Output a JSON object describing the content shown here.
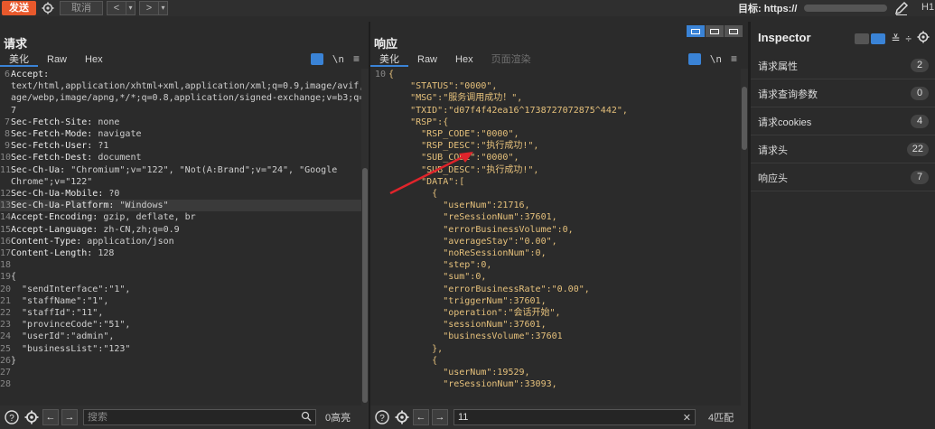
{
  "toolbar": {
    "send_label": "发送",
    "cancel_label": "取消",
    "back_label": "<",
    "forward_label": ">",
    "dropdown_label": "▾",
    "target_label": "目标: https://",
    "http_version": "H1"
  },
  "request": {
    "title": "请求",
    "tabs": [
      {
        "label": "美化"
      },
      {
        "label": "Raw"
      },
      {
        "label": "Hex"
      }
    ],
    "newline_label": "\\n",
    "lines": [
      {
        "n": "6",
        "k": "Accept:",
        "v": ""
      },
      {
        "n": "",
        "k": "",
        "v": "text/html,application/xhtml+xml,application/xml;q=0.9,image/avif,im"
      },
      {
        "n": "",
        "k": "",
        "v": "age/webp,image/apng,*/*;q=0.8,application/signed-exchange;v=b3;q=0."
      },
      {
        "n": "",
        "k": "",
        "v": "7"
      },
      {
        "n": "7",
        "k": "Sec-Fetch-Site:",
        "v": " none"
      },
      {
        "n": "8",
        "k": "Sec-Fetch-Mode:",
        "v": " navigate"
      },
      {
        "n": "9",
        "k": "Sec-Fetch-User:",
        "v": " ?1"
      },
      {
        "n": "10",
        "k": "Sec-Fetch-Dest:",
        "v": " document"
      },
      {
        "n": "11",
        "k": "Sec-Ch-Ua:",
        "v": " \"Chromium\";v=\"122\", \"Not(A:Brand\";v=\"24\", \"Google"
      },
      {
        "n": "",
        "k": "",
        "v": "Chrome\";v=\"122\""
      },
      {
        "n": "12",
        "k": "Sec-Ch-Ua-Mobile:",
        "v": " ?0"
      },
      {
        "n": "13",
        "k": "Sec-Ch-Ua-Platform:",
        "v": " \"Windows\""
      },
      {
        "n": "14",
        "k": "Accept-Encoding:",
        "v": " gzip, deflate, br"
      },
      {
        "n": "15",
        "k": "Accept-Language:",
        "v": " zh-CN,zh;q=0.9"
      },
      {
        "n": "16",
        "k": "Content-Type:",
        "v": " application/json"
      },
      {
        "n": "17",
        "k": "Content-Length:",
        "v": " 128"
      },
      {
        "n": "18",
        "k": "",
        "v": ""
      },
      {
        "n": "19",
        "k": "",
        "v": "{"
      },
      {
        "n": "20",
        "k": "",
        "v": "  \"sendInterface\":\"1\","
      },
      {
        "n": "21",
        "k": "",
        "v": "  \"staffName\":\"1\","
      },
      {
        "n": "22",
        "k": "",
        "v": "  \"staffId\":\"11\","
      },
      {
        "n": "23",
        "k": "",
        "v": "  \"provinceCode\":\"51\","
      },
      {
        "n": "24",
        "k": "",
        "v": "  \"userId\":\"admin\","
      },
      {
        "n": "25",
        "k": "",
        "v": "  \"businessList\":\"123\""
      },
      {
        "n": "26",
        "k": "",
        "v": "}"
      },
      {
        "n": "27",
        "k": "",
        "v": ""
      },
      {
        "n": "28",
        "k": "",
        "v": ""
      }
    ],
    "highlight_line": 11,
    "search_placeholder": "搜索",
    "match_count": "0高亮"
  },
  "response": {
    "title": "响应",
    "tabs": [
      {
        "label": "美化"
      },
      {
        "label": "Raw"
      },
      {
        "label": "Hex"
      },
      {
        "label": "页面渲染"
      }
    ],
    "newline_label": "\\n",
    "lines": [
      {
        "n": "10",
        "t": "{"
      },
      {
        "n": "",
        "t": "    \"STATUS\":\"0000\","
      },
      {
        "n": "",
        "t": "    \"MSG\":\"服务调用成功！\","
      },
      {
        "n": "",
        "t": "    \"TXID\":\"d07f4f42ea16^1738727072875^442\","
      },
      {
        "n": "",
        "t": "    \"RSP\":{"
      },
      {
        "n": "",
        "t": "      \"RSP_CODE\":\"0000\","
      },
      {
        "n": "",
        "t": "      \"RSP_DESC\":\"执行成功!\","
      },
      {
        "n": "",
        "t": "      \"SUB_CODE\":\"0000\","
      },
      {
        "n": "",
        "t": "      \"SUB_DESC\":\"执行成功!\","
      },
      {
        "n": "",
        "t": "      \"DATA\":["
      },
      {
        "n": "",
        "t": "        {"
      },
      {
        "n": "",
        "t": "          \"userNum\":21716,"
      },
      {
        "n": "",
        "t": "          \"reSessionNum\":37601,"
      },
      {
        "n": "",
        "t": "          \"errorBusinessVolume\":0,"
      },
      {
        "n": "",
        "t": "          \"averageStay\":\"0.00\","
      },
      {
        "n": "",
        "t": "          \"noReSessionNum\":0,"
      },
      {
        "n": "",
        "t": "          \"step\":0,"
      },
      {
        "n": "",
        "t": "          \"sum\":0,"
      },
      {
        "n": "",
        "t": "          \"errorBusinessRate\":\"0.00\","
      },
      {
        "n": "",
        "t": "          \"triggerNum\":37601,"
      },
      {
        "n": "",
        "t": "          \"operation\":\"会话开始\","
      },
      {
        "n": "",
        "t": "          \"sessionNum\":37601,"
      },
      {
        "n": "",
        "t": "          \"businessVolume\":37601"
      },
      {
        "n": "",
        "t": "        },"
      },
      {
        "n": "",
        "t": "        {"
      },
      {
        "n": "",
        "t": "          \"userNum\":19529,"
      },
      {
        "n": "",
        "t": "          \"reSessionNum\":33093,"
      }
    ],
    "search_value": "11",
    "match_count": "4匹配"
  },
  "inspector": {
    "title": "Inspector",
    "rows": [
      {
        "label": "请求属性",
        "count": "2"
      },
      {
        "label": "请求查询参数",
        "count": "0"
      },
      {
        "label": "请求cookies",
        "count": "4"
      },
      {
        "label": "请求头",
        "count": "22"
      },
      {
        "label": "响应头",
        "count": "7"
      }
    ]
  },
  "colors": {
    "send": "#e8592c",
    "accent": "#3a83d6",
    "annotation_arrow": "#e0242b"
  }
}
